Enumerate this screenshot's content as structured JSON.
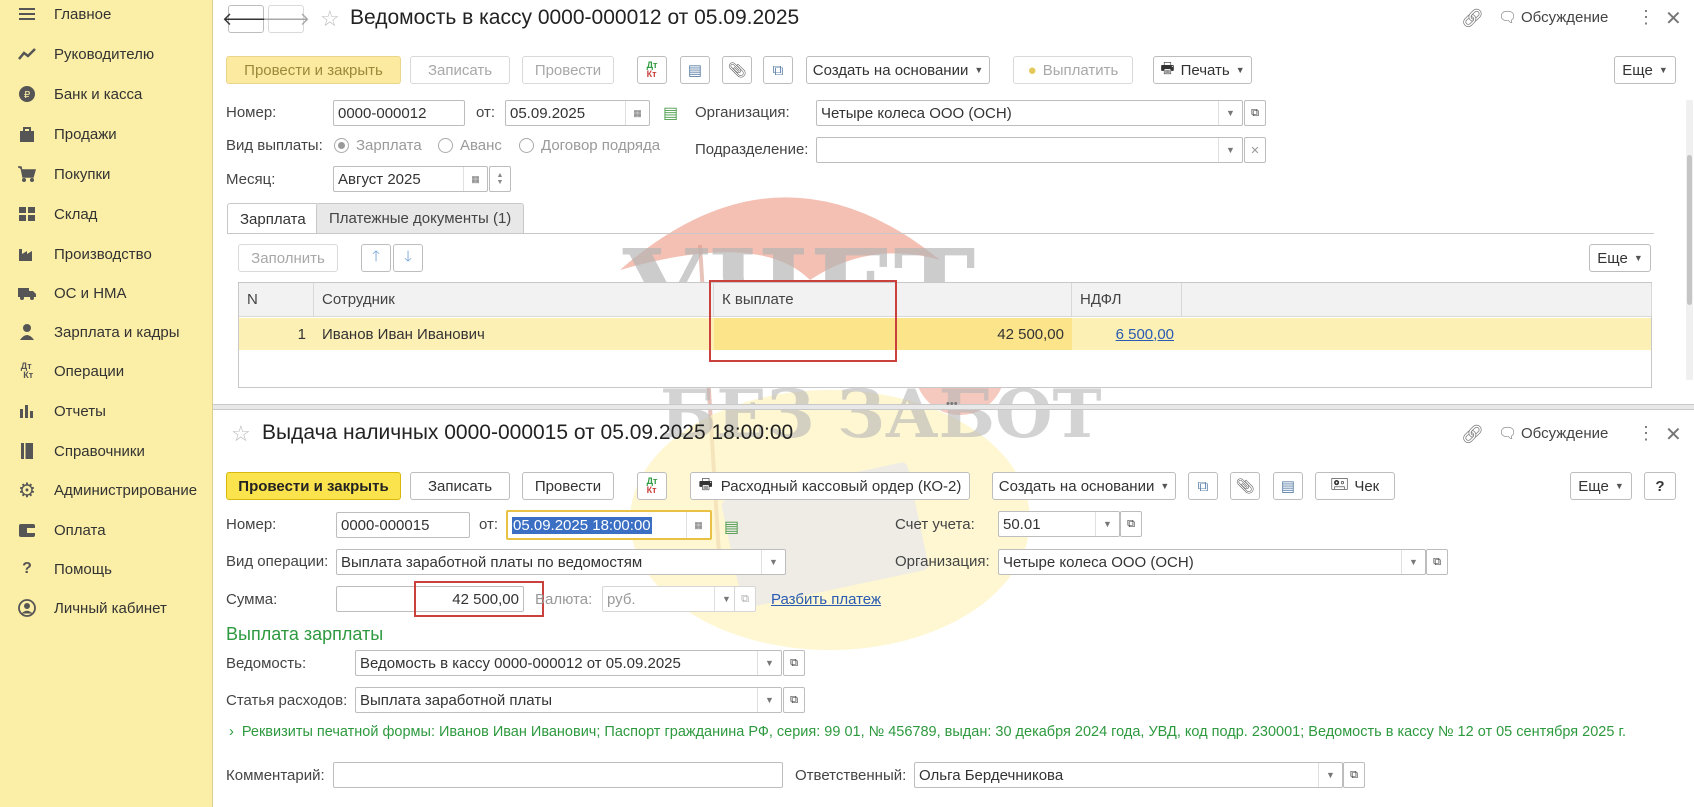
{
  "sidebar": {
    "items": [
      {
        "label": "Главное",
        "icon": "menu-icon"
      },
      {
        "label": "Руководителю",
        "icon": "trend-icon"
      },
      {
        "label": "Банк и касса",
        "icon": "coin-icon"
      },
      {
        "label": "Продажи",
        "icon": "bag-icon"
      },
      {
        "label": "Покупки",
        "icon": "cart-icon"
      },
      {
        "label": "Склад",
        "icon": "warehouse-icon"
      },
      {
        "label": "Производство",
        "icon": "factory-icon"
      },
      {
        "label": "ОС и НМА",
        "icon": "truck-icon"
      },
      {
        "label": "Зарплата и кадры",
        "icon": "person-icon"
      },
      {
        "label": "Операции",
        "icon": "debit-credit-icon"
      },
      {
        "label": "Отчеты",
        "icon": "bar-chart-icon"
      },
      {
        "label": "Справочники",
        "icon": "book-icon"
      },
      {
        "label": "Администрирование",
        "icon": "gear-icon"
      },
      {
        "label": "Оплата",
        "icon": "wallet-icon"
      },
      {
        "label": "Помощь",
        "icon": "question-icon"
      },
      {
        "label": "Личный кабинет",
        "icon": "user-circle-icon"
      }
    ]
  },
  "top": {
    "title": "Ведомость в кассу 0000-000012 от 05.09.2025",
    "discussion": "Обсуждение",
    "toolbar": {
      "post_close": "Провести и закрыть",
      "save": "Записать",
      "post": "Провести",
      "dtkt": "Дт\nКт",
      "create_based": "Создать на основании",
      "pay": "Выплатить",
      "print": "Печать",
      "more": "Еще"
    },
    "number_label": "Номер:",
    "number": "0000-000012",
    "from_label": "от:",
    "date": "05.09.2025",
    "org_label": "Организация:",
    "org": "Четыре колеса ООО (ОСН)",
    "paytype_label": "Вид выплаты:",
    "paytype_options": [
      "Зарплата",
      "Аванс",
      "Договор подряда"
    ],
    "dept_label": "Подразделение:",
    "dept": "",
    "month_label": "Месяц:",
    "month": "Август 2025",
    "tabs": [
      "Зарплата",
      "Платежные документы (1)"
    ],
    "fill": "Заполнить",
    "grid_more": "Еще",
    "columns": [
      "N",
      "Сотрудник",
      "К выплате",
      "НДФЛ"
    ],
    "rows": [
      {
        "n": "1",
        "employee": "Иванов Иван Иванович",
        "amount": "42 500,00",
        "ndfl": "6 500,00"
      }
    ]
  },
  "bottom": {
    "title": "Выдача наличных 0000-000015 от 05.09.2025 18:00:00",
    "discussion": "Обсуждение",
    "toolbar": {
      "post_close": "Провести и закрыть",
      "save": "Записать",
      "post": "Провести",
      "dtkt": "Дт\nКт",
      "cash_order": "Расходный кассовый ордер (КО-2)",
      "create_based": "Создать на основании",
      "check": "Чек",
      "more": "Еще",
      "help": "?"
    },
    "number_label": "Номер:",
    "number": "0000-000015",
    "from_label": "от:",
    "date": "05.09.2025 18:00:00",
    "account_label": "Счет учета:",
    "account": "50.01",
    "optype_label": "Вид операции:",
    "optype": "Выплата заработной платы по ведомостям",
    "org_label": "Организация:",
    "org": "Четыре колеса ООО (ОСН)",
    "sum_label": "Сумма:",
    "sum": "42 500,00",
    "currency_label": "Валюта:",
    "currency": "руб.",
    "split": "Разбить платеж",
    "section": "Выплата зарплаты",
    "statement_label": "Ведомость:",
    "statement": "Ведомость в кассу 0000-000012 от 05.09.2025",
    "expense_label": "Статья расходов:",
    "expense": "Выплата заработной платы",
    "requisites": "Реквизиты печатной формы: Иванов Иван Иванович; Паспорт гражданина РФ, серия: 99 01, № 456789, выдан: 30 декабря 2024 года, УВД, код подр. 230001; Ведомость в кассу № 12 от 05 сентября 2025 г.",
    "comment_label": "Комментарий:",
    "comment": "",
    "responsible_label": "Ответственный:",
    "responsible": "Ольга Бердечникова"
  },
  "watermark": {
    "line1": "УЧЕТ",
    "line2": "БЕЗ ЗАБОТ"
  },
  "colors": {
    "sidebar": "#fbeea6",
    "accent_button": "#fbe34d",
    "row_highlight": "#fdf0b5",
    "red_box": "#c9403c",
    "green_text": "#2e9a3f",
    "link": "#2a5bb1"
  }
}
